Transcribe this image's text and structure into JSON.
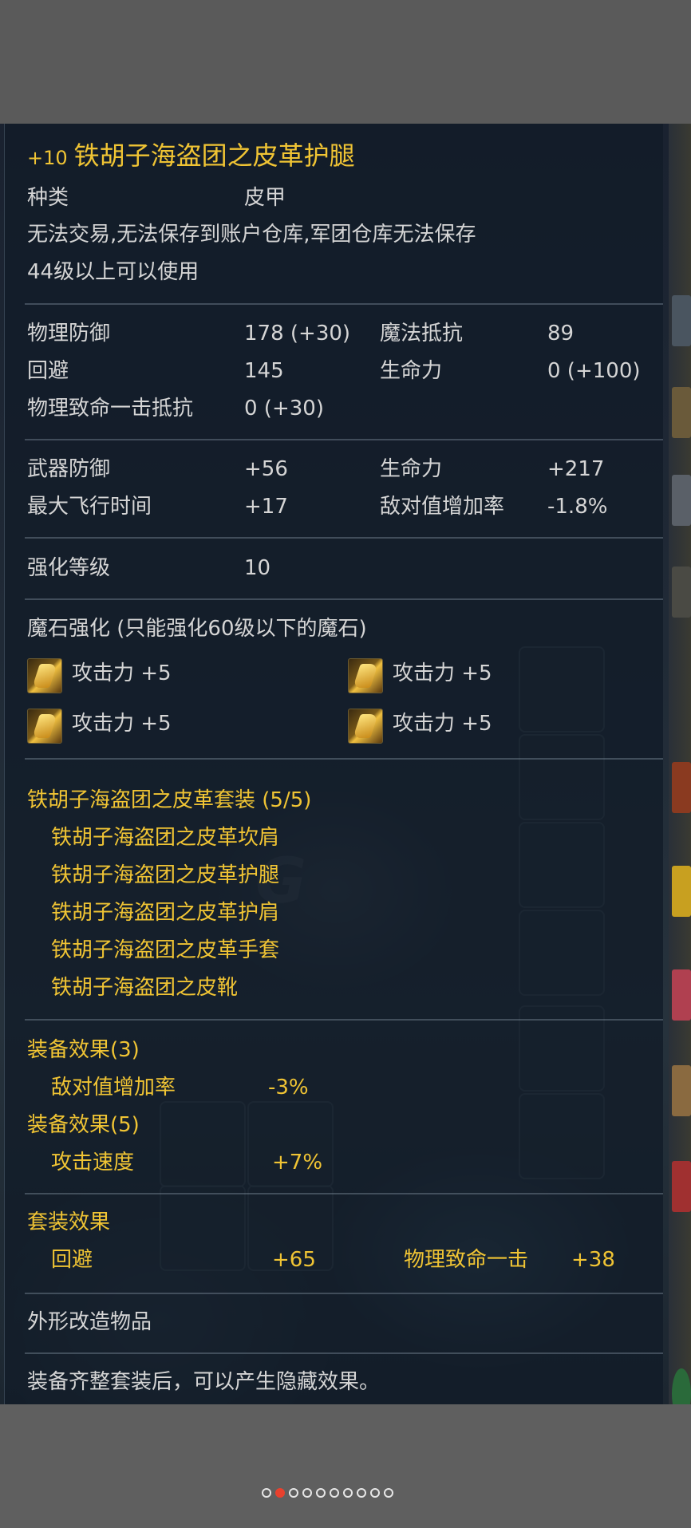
{
  "item": {
    "enhance": "+10",
    "name": "铁胡子海盗团之皮革护腿",
    "category_label": "种类",
    "category_value": "皮甲",
    "restriction": "无法交易,无法保存到账户仓库,军团仓库无法保存",
    "level_req": "44级以上可以使用"
  },
  "base_stats": [
    {
      "label": "物理防御",
      "value": "178 (+30)"
    },
    {
      "label": "魔法抵抗",
      "value": "89"
    },
    {
      "label": "回避",
      "value": "145"
    },
    {
      "label": "生命力",
      "value": "0 (+100)"
    },
    {
      "label": "物理致命一击抵抗",
      "value": "0 (+30)"
    }
  ],
  "bonus_stats": [
    {
      "label": "武器防御",
      "value": "+56"
    },
    {
      "label": "生命力",
      "value": "+217"
    },
    {
      "label": "最大飞行时间",
      "value": "+17"
    },
    {
      "label": "敌对值增加率",
      "value": "-1.8%"
    }
  ],
  "enhance_level": {
    "label": "强化等级",
    "value": "10"
  },
  "manastones": {
    "header": "魔石强化 (只能强化60级以下的魔石)",
    "slots": [
      {
        "text": "攻击力 +5",
        "icon": "manastone-icon"
      },
      {
        "text": "攻击力 +5",
        "icon": "manastone-icon"
      },
      {
        "text": "攻击力 +5",
        "icon": "manastone-icon"
      },
      {
        "text": "攻击力 +5",
        "icon": "manastone-icon"
      }
    ]
  },
  "set": {
    "title": "铁胡子海盗团之皮革套装 (5/5)",
    "pieces": [
      "铁胡子海盗团之皮革坎肩",
      "铁胡子海盗团之皮革护腿",
      "铁胡子海盗团之皮革护肩",
      "铁胡子海盗团之皮革手套",
      "铁胡子海盗团之皮靴"
    ]
  },
  "equip_effects": [
    {
      "header": "装备效果(3)",
      "label": "敌对值增加率",
      "value": "-3%"
    },
    {
      "header": "装备效果(5)",
      "label": "攻击速度",
      "value": "+7%"
    }
  ],
  "set_effect": {
    "header": "套装效果",
    "items": [
      {
        "label": "回避",
        "value": "+65"
      },
      {
        "label": "物理致命一击",
        "value": "+38"
      }
    ]
  },
  "appearance": "外形改造物品",
  "footer_note": "装备齐整套装后，可以产生隐藏效果。",
  "colors": {
    "gold": "#f0c434",
    "text": "#d5d5d5",
    "panel": "#111c28"
  },
  "pagination": {
    "total": 10,
    "active": 2
  }
}
